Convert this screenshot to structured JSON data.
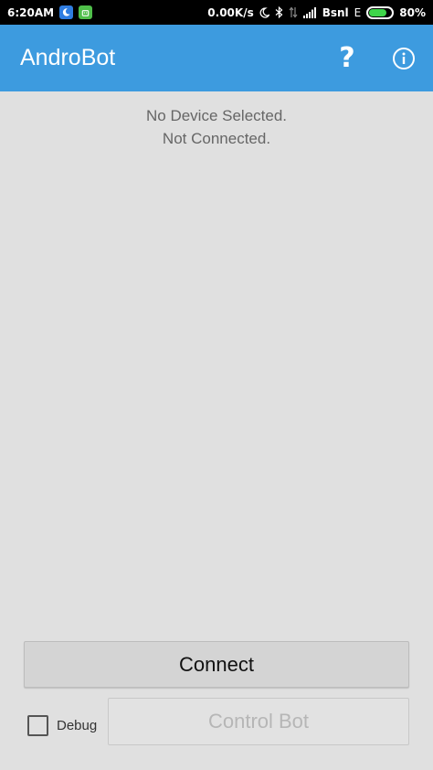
{
  "status_bar": {
    "time": "6:20AM",
    "network_speed": "0.00K/s",
    "carrier": "Bsnl",
    "network_type": "E",
    "battery_percent": "80%",
    "battery_level": 0.8,
    "icons": [
      "moon-app-icon",
      "android-app-icon",
      "moon-icon",
      "bluetooth-icon",
      "data-arrows-icon",
      "signal-icon",
      "battery-icon"
    ]
  },
  "app_bar": {
    "title": "AndroBot",
    "help_label": "?",
    "background": "#3d9bdf"
  },
  "main": {
    "device_status": "No Device Selected.",
    "connection_status": "Not Connected."
  },
  "controls": {
    "connect_label": "Connect",
    "debug_label": "Debug",
    "debug_checked": false,
    "control_bot_label": "Control Bot",
    "control_bot_enabled": false
  }
}
